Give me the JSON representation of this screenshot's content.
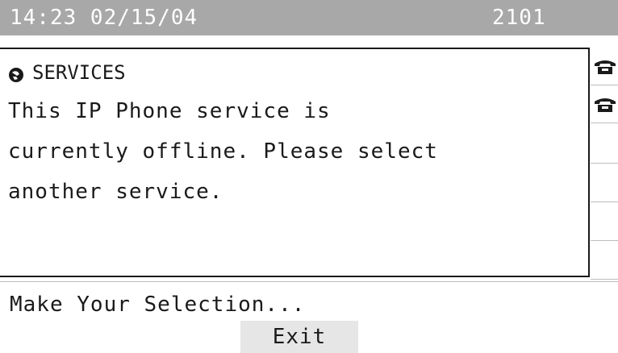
{
  "status_bar": {
    "datetime": "14:23 02/15/04",
    "extension": "2101"
  },
  "content": {
    "header_icon": "services-globe-icon",
    "header_title": "SERVICES",
    "message": "This IP Phone service is\ncurrently offline. Please select\nanother service."
  },
  "line_keys": [
    {
      "icon": "phone-handset-icon"
    },
    {
      "icon": "phone-handset-icon"
    },
    {
      "icon": ""
    },
    {
      "icon": ""
    },
    {
      "icon": ""
    },
    {
      "icon": ""
    }
  ],
  "prompt": "Make Your Selection...",
  "softkeys": {
    "exit_label": "Exit"
  },
  "colors": {
    "status_bar_bg": "#a8a8a8",
    "softkey_bg": "#e6e6e6",
    "text": "#1a1a1a"
  }
}
